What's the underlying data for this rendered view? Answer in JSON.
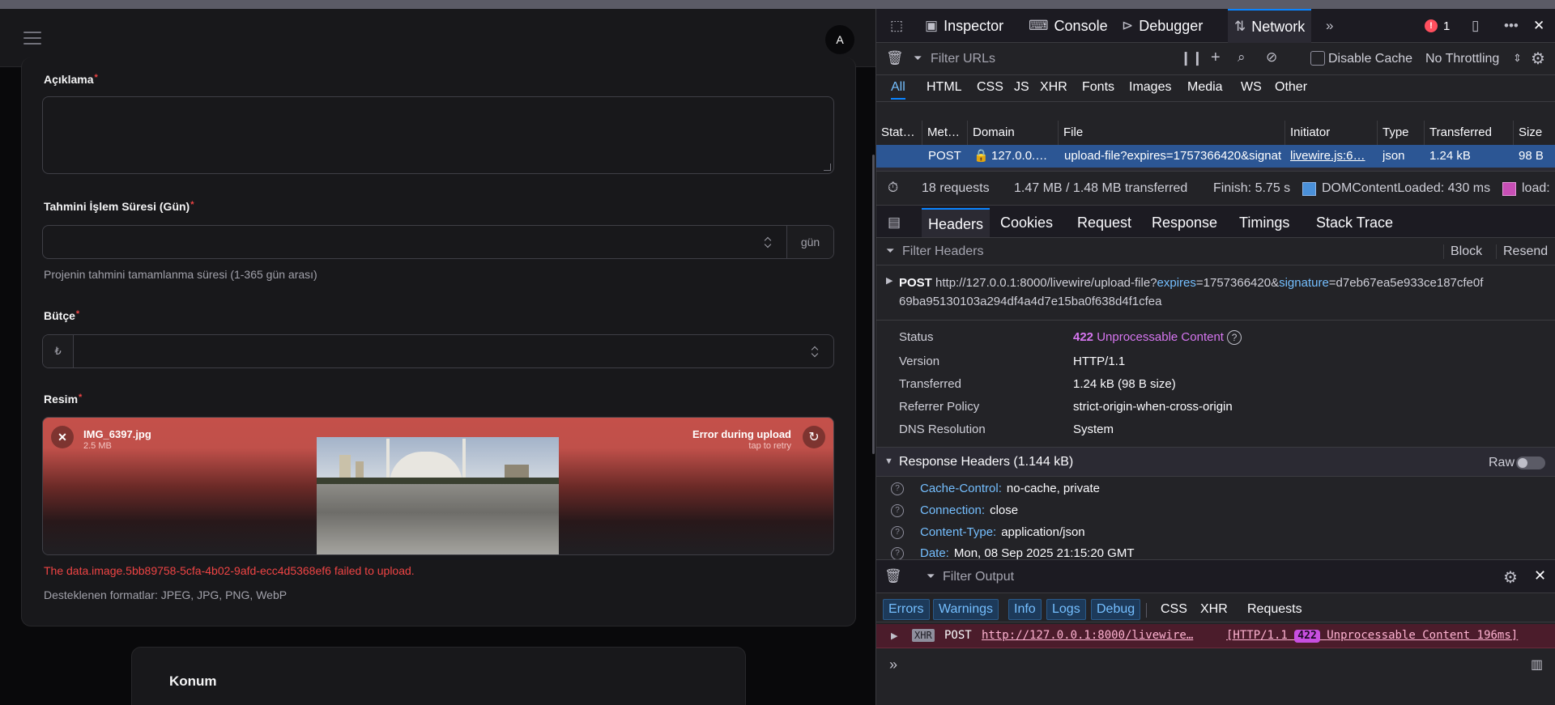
{
  "app": {
    "avatar_initial": "A",
    "fields": {
      "description_label": "Açıklama",
      "duration_label": "Tahmini İşlem Süresi (Gün)",
      "duration_suffix": "gün",
      "duration_hint": "Projenin tahmini tamamlanma süresi (1-365 gün arası)",
      "budget_label": "Bütçe",
      "budget_prefix": "₺",
      "image_label": "Resim",
      "required_mark": "*"
    },
    "upload": {
      "file_name": "IMG_6397.jpg",
      "file_size": "2.5 MB",
      "status": "Error during upload",
      "retry_hint": "tap to retry",
      "error_message": "The data.image.5bb89758-5cfa-4b02-9afd-ecc4d5368ef6 failed to upload.",
      "formats_hint": "Desteklenen formatlar: JPEG, JPG, PNG, WebP",
      "status_color": "#c4504a"
    },
    "section2_title": "Konum"
  },
  "devtools": {
    "tabs": [
      "Inspector",
      "Console",
      "Debugger",
      "Network"
    ],
    "active_tab": "Network",
    "error_count": "1",
    "toolbar": {
      "filter_placeholder": "Filter URLs",
      "disable_cache": "Disable Cache",
      "throttling": "No Throttling"
    },
    "type_filters": [
      "All",
      "HTML",
      "CSS",
      "JS",
      "XHR",
      "Fonts",
      "Images",
      "Media",
      "WS",
      "Other"
    ],
    "columns": [
      "Stat…",
      "Met…",
      "Domain",
      "File",
      "Initiator",
      "Type",
      "Transferred",
      "Size"
    ],
    "selected_request": {
      "status": "422",
      "method": "POST",
      "domain": "127.0.0.…",
      "file": "upload-file?expires=1757366420&signature",
      "initiator": "livewire.js:6…",
      "type": "json",
      "transferred": "1.24 kB",
      "size": "98 B"
    },
    "summary": {
      "requests": "18 requests",
      "transferred": "1.47 MB / 1.48 MB transferred",
      "finish": "Finish: 5.75 s",
      "dcl": "DOMContentLoaded: 430 ms",
      "load": "load:"
    },
    "detail_tabs": [
      "Headers",
      "Cookies",
      "Request",
      "Response",
      "Timings",
      "Stack Trace"
    ],
    "headers_filter_placeholder": "Filter Headers",
    "block": "Block",
    "resend": "Resend",
    "request_line": {
      "method": "POST",
      "url_base": "http://127.0.0.1:8000/livewire/upload-file?",
      "param1": "expires",
      "val1": "=1757366420&",
      "param2": "signature",
      "val2": "=d7eb67ea5e933ce187cfe0f",
      "url_cont": "69ba95130103a294df4a4d7e15ba0f638d4f1cfea"
    },
    "info": [
      {
        "k": "Status",
        "v": "Unprocessable Content",
        "code": "422"
      },
      {
        "k": "Version",
        "v": "HTTP/1.1"
      },
      {
        "k": "Transferred",
        "v": "1.24 kB (98 B size)"
      },
      {
        "k": "Referrer Policy",
        "v": "strict-origin-when-cross-origin"
      },
      {
        "k": "DNS Resolution",
        "v": "System"
      }
    ],
    "response_headers_title": "Response Headers (1.144 kB)",
    "raw_label": "Raw",
    "response_headers": [
      {
        "name": "Cache-Control:",
        "value": "no-cache, private"
      },
      {
        "name": "Connection:",
        "value": "close"
      },
      {
        "name": "Content-Type:",
        "value": "application/json"
      },
      {
        "name": "Date:",
        "value": "Mon, 08 Sep 2025 21:15:20 GMT"
      }
    ],
    "console": {
      "filter_placeholder": "Filter Output",
      "level_tabs": [
        "Errors",
        "Warnings",
        "Info",
        "Logs",
        "Debug"
      ],
      "type_tabs": [
        "CSS",
        "XHR",
        "Requests"
      ],
      "log": {
        "tag": "XHR",
        "method": "POST",
        "url": "http://127.0.0.1:8000/livewire…",
        "proto": "[HTTP/1.1",
        "code": "422",
        "text": "Unprocessable Content 196ms]"
      }
    }
  }
}
